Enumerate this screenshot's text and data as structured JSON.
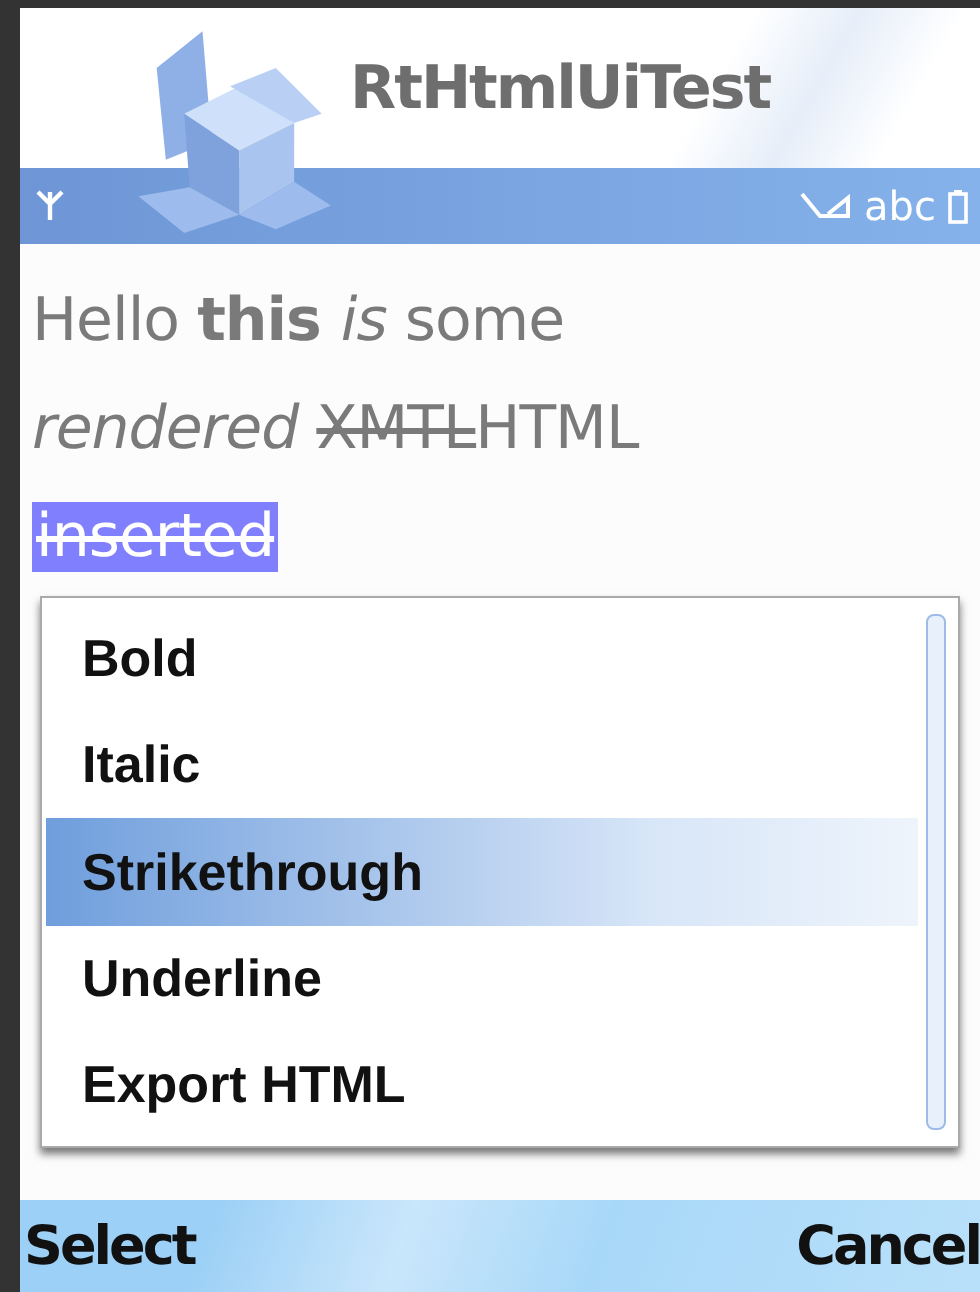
{
  "window": {
    "title": "RtHtmlUiTest"
  },
  "status_bar": {
    "input_mode": "abc"
  },
  "document": {
    "lines": [
      [
        {
          "text": "Hello ",
          "kind": "plain"
        },
        {
          "text": "this ",
          "kind": "bold"
        },
        {
          "text": "is",
          "kind": "italic"
        },
        {
          "text": " some",
          "kind": "plain"
        }
      ],
      [
        {
          "text": "rendered ",
          "kind": "italic"
        },
        {
          "text": "XMTL",
          "kind": "strike"
        },
        {
          "text": "HTML",
          "kind": "plain"
        }
      ],
      [
        {
          "text": "inserted",
          "kind": "inserted"
        }
      ]
    ]
  },
  "menu": {
    "items": [
      {
        "label": "Bold",
        "selected": false
      },
      {
        "label": "Italic",
        "selected": false
      },
      {
        "label": "Strikethrough",
        "selected": true
      },
      {
        "label": "Underline",
        "selected": false
      },
      {
        "label": "Export HTML",
        "selected": false
      }
    ]
  },
  "softkeys": {
    "left": "Select",
    "right": "Cancel"
  }
}
